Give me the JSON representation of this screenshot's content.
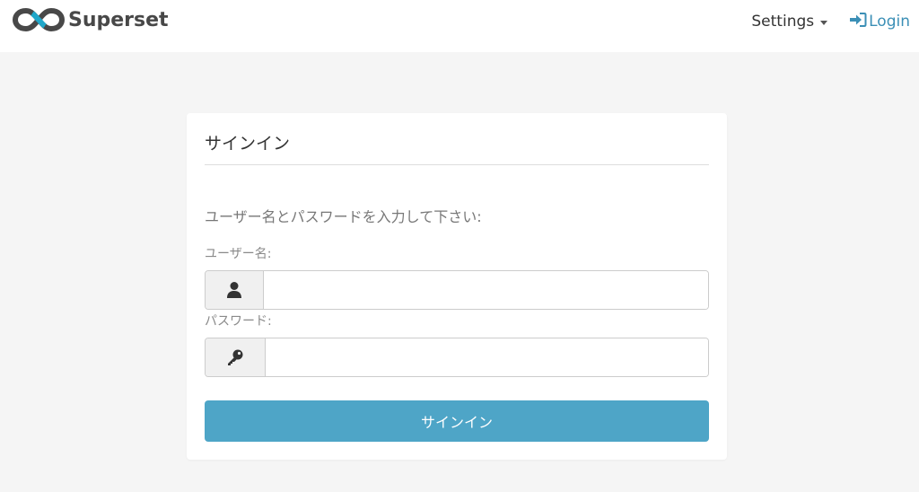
{
  "navbar": {
    "brand_name": "Superset",
    "settings_label": "Settings",
    "login_label": "Login"
  },
  "icons": {
    "logo": "superset-infinity-logo-icon",
    "settings_caret": "caret-down-icon",
    "login": "sign-in-icon",
    "username": "user-icon",
    "password": "key-icon"
  },
  "colors": {
    "accent": "#4ea5c7",
    "link": "#3b8fb6",
    "logo_dark": "#484848",
    "logo_light": "#20a7c9",
    "page_bg": "#f5f5f5"
  },
  "login_form": {
    "title": "サインイン",
    "instructions": "ユーザー名とパスワードを入力して下さい:",
    "username_label": "ユーザー名:",
    "username_value": "",
    "password_label": "パスワード:",
    "password_value": "",
    "submit_label": "サインイン"
  }
}
